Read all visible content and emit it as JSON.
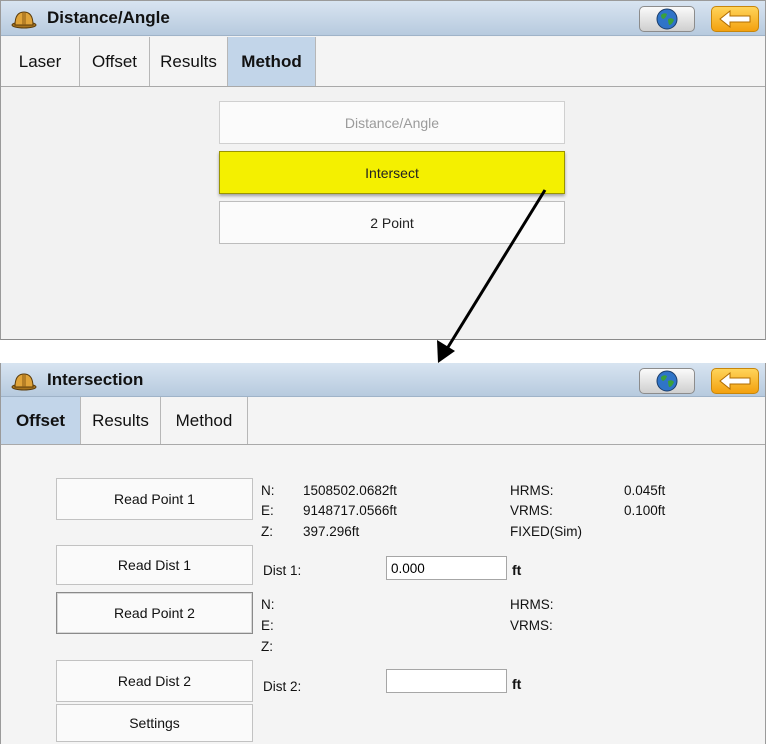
{
  "top": {
    "title": "Distance/Angle",
    "tabs": [
      "Laser",
      "Offset",
      "Results",
      "Method"
    ],
    "active_tab": "Method",
    "methods": [
      "Distance/Angle",
      "Intersect",
      "2 Point"
    ],
    "selected_method": "Intersect"
  },
  "bottom": {
    "title": "Intersection",
    "tabs": [
      "Offset",
      "Results",
      "Method"
    ],
    "active_tab": "Offset",
    "buttons": {
      "read_point_1": "Read Point 1",
      "read_dist_1": "Read Dist 1",
      "read_point_2": "Read Point 2",
      "read_dist_2": "Read Dist 2",
      "settings": "Settings"
    },
    "point1": {
      "n_label": "N:",
      "n_value": "1508502.0682ft",
      "e_label": "E:",
      "e_value": "9148717.0566ft",
      "z_label": "Z:",
      "z_value": "397.296ft",
      "hrms_label": "HRMS:",
      "hrms_value": "0.045ft",
      "vrms_label": "VRMS:",
      "vrms_value": "0.100ft",
      "status": "FIXED(Sim)"
    },
    "dist1": {
      "label": "Dist 1:",
      "value": "0.000",
      "unit": "ft"
    },
    "point2": {
      "n_label": "N:",
      "e_label": "E:",
      "z_label": "Z:",
      "hrms_label": "HRMS:",
      "vrms_label": "VRMS:"
    },
    "dist2": {
      "label": "Dist 2:",
      "value": "",
      "unit": "ft"
    }
  },
  "icons": {
    "app": "hard-hat-icon",
    "globe": "globe-icon",
    "back": "back-arrow-icon"
  },
  "colors": {
    "titlebar": "#c4d4e6",
    "active_tab": "#c2d5e9",
    "selected_method": "#f4f000",
    "back_button": "#f3a10f"
  }
}
